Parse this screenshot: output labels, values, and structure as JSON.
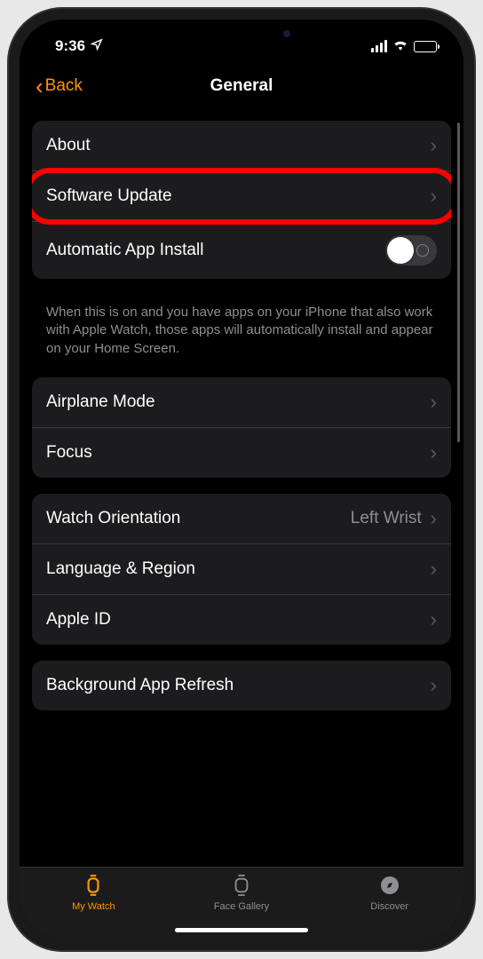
{
  "status": {
    "time": "9:36"
  },
  "nav": {
    "back_label": "Back",
    "title": "General"
  },
  "groups": {
    "g1": {
      "about": "About",
      "software_update": "Software Update",
      "auto_install": "Automatic App Install",
      "footer": "When this is on and you have apps on your iPhone that also work with Apple Watch, those apps will automatically install and appear on your Home Screen."
    },
    "g2": {
      "airplane": "Airplane Mode",
      "focus": "Focus"
    },
    "g3": {
      "orientation": "Watch Orientation",
      "orientation_value": "Left Wrist",
      "language": "Language & Region",
      "apple_id": "Apple ID"
    },
    "g4": {
      "background_refresh": "Background App Refresh"
    }
  },
  "tabs": {
    "my_watch": "My Watch",
    "face_gallery": "Face Gallery",
    "discover": "Discover"
  }
}
